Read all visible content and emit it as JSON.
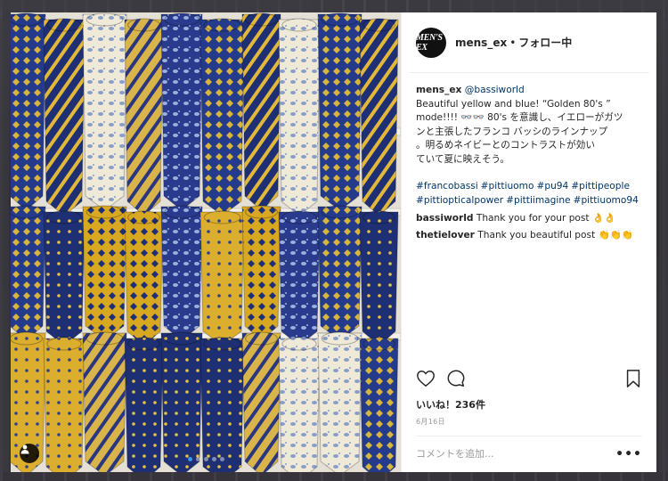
{
  "post": {
    "account_logo_text": "MEN'S EX",
    "account": "mens_ex",
    "separator": "•",
    "follow_status": "フォロー中",
    "caption_user": "mens_ex",
    "caption_mention": "@bassiworld",
    "caption_line1": "Beautiful yellow and blue! “Golden 80's ”",
    "caption_line2": "mode!!!! 👓👓 80's を意識し、イエローがガツ",
    "caption_line3": "ンと主張したフランコ バッシのラインナップ",
    "caption_line4": "。明るめネイビーとのコントラストが効い",
    "caption_line5": "ていて夏に映えそう。",
    "hashtags": [
      "#francobassi",
      "#pittiuomo",
      "#pu94",
      "#pittipeople",
      "#pittiopticalpower",
      "#pittiimagine",
      "#pittiuomo94"
    ],
    "comments": [
      {
        "user": "bassiworld",
        "text": "Thank you for your post 👌👌"
      },
      {
        "user": "thetielover",
        "text": "Thank you beautiful post 👏👏👏"
      }
    ],
    "likes": "いいね！236件",
    "date": "6月16日",
    "comment_placeholder": "コメントを追加...",
    "more_label": "•••"
  },
  "carousel": {
    "count": 5,
    "active": 0
  },
  "icons": {
    "like": "heart-outline-icon",
    "comment": "speech-bubble-icon",
    "save": "bookmark-icon",
    "user_tag": "person-tag-icon"
  },
  "colors": {
    "link": "#003569",
    "text": "#262626",
    "muted": "#999999",
    "active_dot": "#3897f0",
    "navy_tie": "#1f2f73",
    "yellow_tie": "#d9a822"
  }
}
